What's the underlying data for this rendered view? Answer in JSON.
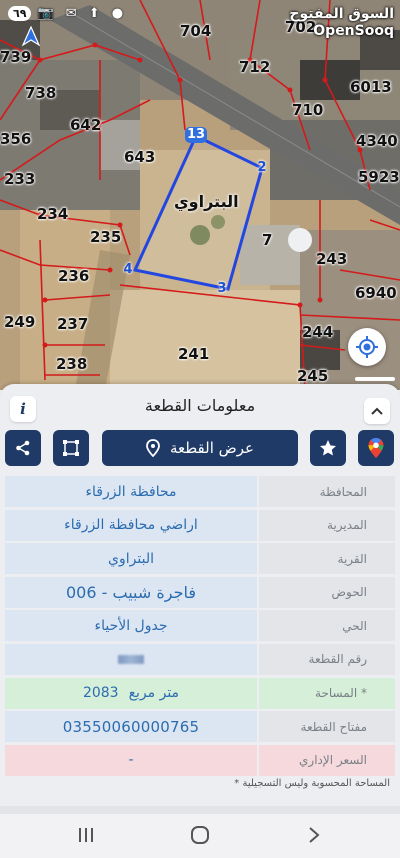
{
  "status_bar": {
    "time": "٦٩",
    "icons": "📷 ✉ ⬆ ●"
  },
  "watermark": {
    "arabic": "السوق المفتوح",
    "english": "OpenSooq"
  },
  "map": {
    "parcels": [
      "704",
      "702",
      "739",
      "712",
      "738",
      "6013",
      "642",
      "710",
      "356",
      "643",
      "4340",
      "233",
      "5923",
      "234",
      "235",
      "7",
      "243",
      "236",
      "6940",
      "249",
      "237",
      "244",
      "241",
      "238",
      "245"
    ],
    "vertices": [
      "13",
      "2",
      "3",
      "4"
    ],
    "village_label": "البتراوي"
  },
  "panel": {
    "title": "معلومات القطعة",
    "view_parcel_label": "عرض القطعة",
    "rows": [
      {
        "label": "المحافظة",
        "value": "محافظة الزرقاء"
      },
      {
        "label": "المديرية",
        "value": "اراضي محافظة الزرقاء"
      },
      {
        "label": "القرية",
        "value": "البتراوي"
      },
      {
        "label": "الحوض",
        "value": "فاجرة شبيب - 006"
      },
      {
        "label": "الحي",
        "value": "جدول الأحياء"
      },
      {
        "label": "رقم القطعة",
        "value": ""
      },
      {
        "label": "المساحة *",
        "value": "2083",
        "unit": "متر مربع"
      },
      {
        "label": "مفتاح القطعة",
        "value": "03550060000765"
      },
      {
        "label": "السعر الإداري",
        "value": "-"
      }
    ],
    "footnote": "* المساحة المحسوبة وليس التسجيلية"
  },
  "colors": {
    "primary": "#1f3a66",
    "value_bg": "#dce6f3",
    "value_text": "#2b6cb0",
    "area_bg": "#d6efd8",
    "price_bg": "#f5d9dc",
    "parcel_outline": "#d41a1a",
    "selection": "#2346e0"
  }
}
